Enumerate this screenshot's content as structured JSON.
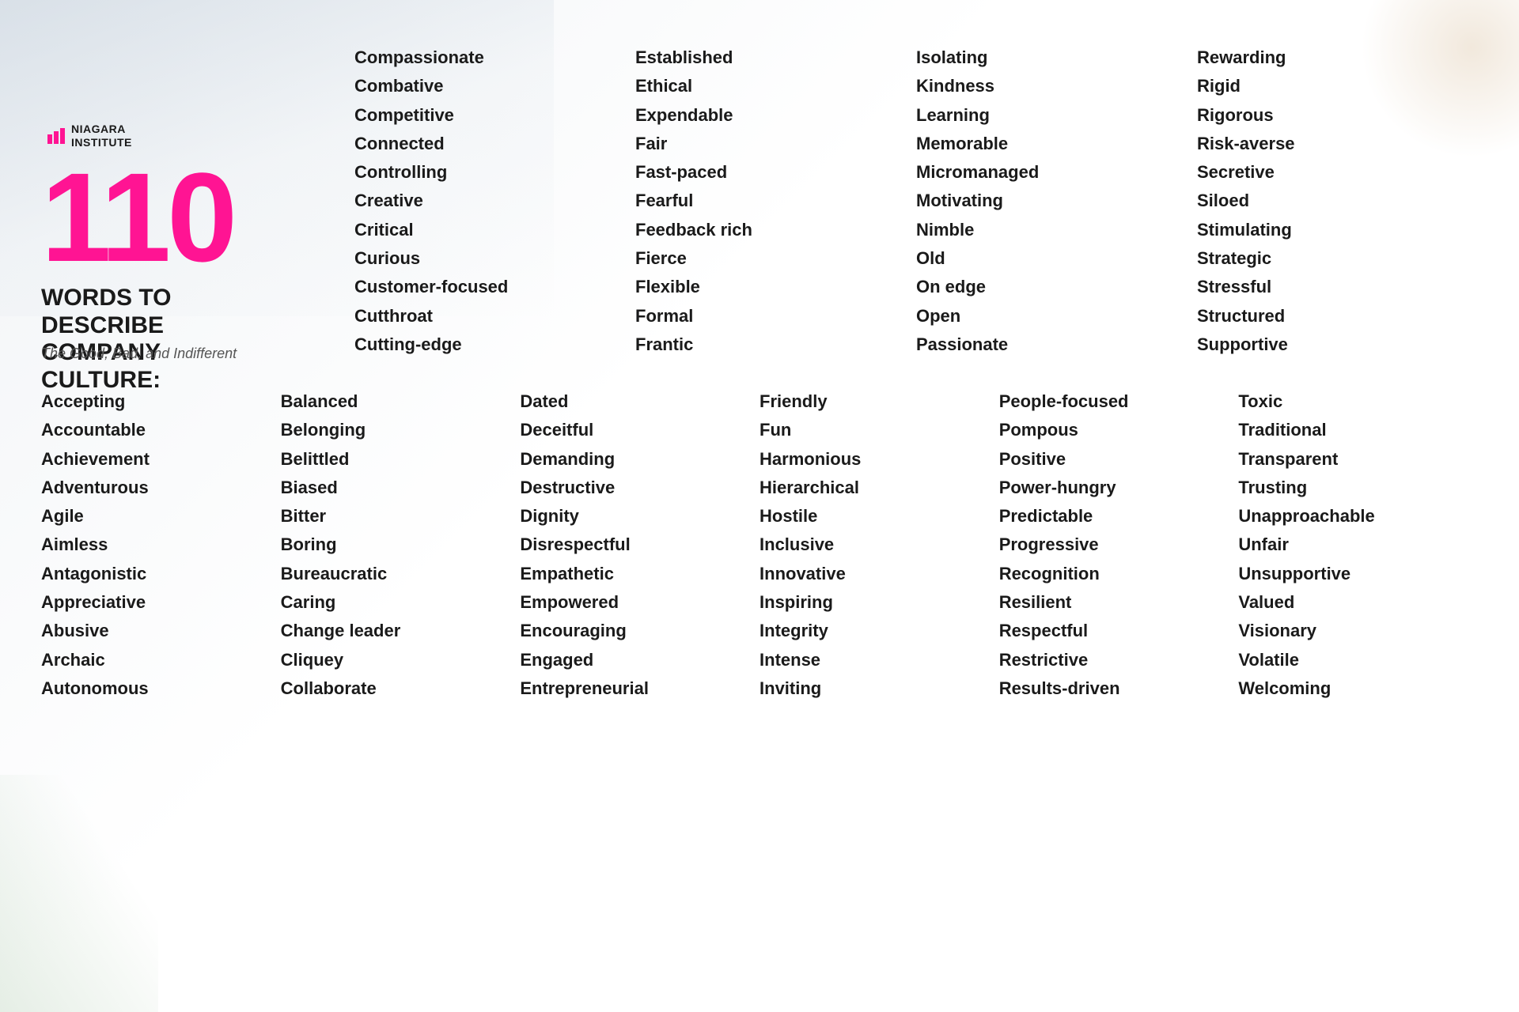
{
  "logo": {
    "line1": "NIAGARA",
    "line2": "INSTITUTE"
  },
  "big_number": "110",
  "heading": "WORDS TO DESCRIBE COMPANY CULTURE:",
  "subheading": "The Good, Bad, and Indifferent",
  "col1_words": [
    "Accepting",
    "Accountable",
    "Achievement",
    "Adventurous",
    "Agile",
    "Aimless",
    "Antagonistic",
    "Appreciative",
    "Abusive",
    "Archaic",
    "Autonomous"
  ],
  "col2_words": [
    "Balanced",
    "Belonging",
    "Belittled",
    "Biased",
    "Bitter",
    "Boring",
    "Bureaucratic",
    "Caring",
    "Change leader",
    "Cliquey",
    "Collaborate"
  ],
  "col3_words": [
    "Compassionate",
    "Combative",
    "Competitive",
    "Connected",
    "Controlling",
    "Creative",
    "Critical",
    "Curious",
    "Customer-focused",
    "Cutthroat",
    "Cutting-edge",
    "Dated",
    "Deceitful",
    "Demanding",
    "Destructive",
    "Dignity",
    "Disrespectful",
    "Empathetic",
    "Empowered",
    "Encouraging",
    "Engaged",
    "Entrepreneurial"
  ],
  "col4_words": [
    "Established",
    "Ethical",
    "Expendable",
    "Fair",
    "Fast-paced",
    "Fearful",
    "Feedback rich",
    "Fierce",
    "Flexible",
    "Formal",
    "Frantic",
    "Friendly",
    "Fun",
    "Harmonious",
    "Hierarchical",
    "Hostile",
    "Inclusive",
    "Innovative",
    "Inspiring",
    "Integrity",
    "Intense",
    "Inviting"
  ],
  "col5_words": [
    "Isolating",
    "Kindness",
    "Learning",
    "Memorable",
    "Micromanaged",
    "Motivating",
    "Nimble",
    "Old",
    "On edge",
    "Open",
    "Passionate",
    "People-focused",
    "Pompous",
    "Positive",
    "Power-hungry",
    "Predictable",
    "Progressive",
    "Recognition",
    "Resilient",
    "Respectful",
    "Restrictive",
    "Results-driven"
  ],
  "col6_words": [
    "Rewarding",
    "Rigid",
    "Rigorous",
    "Risk-averse",
    "Secretive",
    "Siloed",
    "Stimulating",
    "Strategic",
    "Stressful",
    "Structured",
    "Supportive",
    "Toxic",
    "Traditional",
    "Transparent",
    "Trusting",
    "Unapproachable",
    "Unfair",
    "Unsupportive",
    "Valued",
    "Visionary",
    "Volatile",
    "Welcoming"
  ]
}
